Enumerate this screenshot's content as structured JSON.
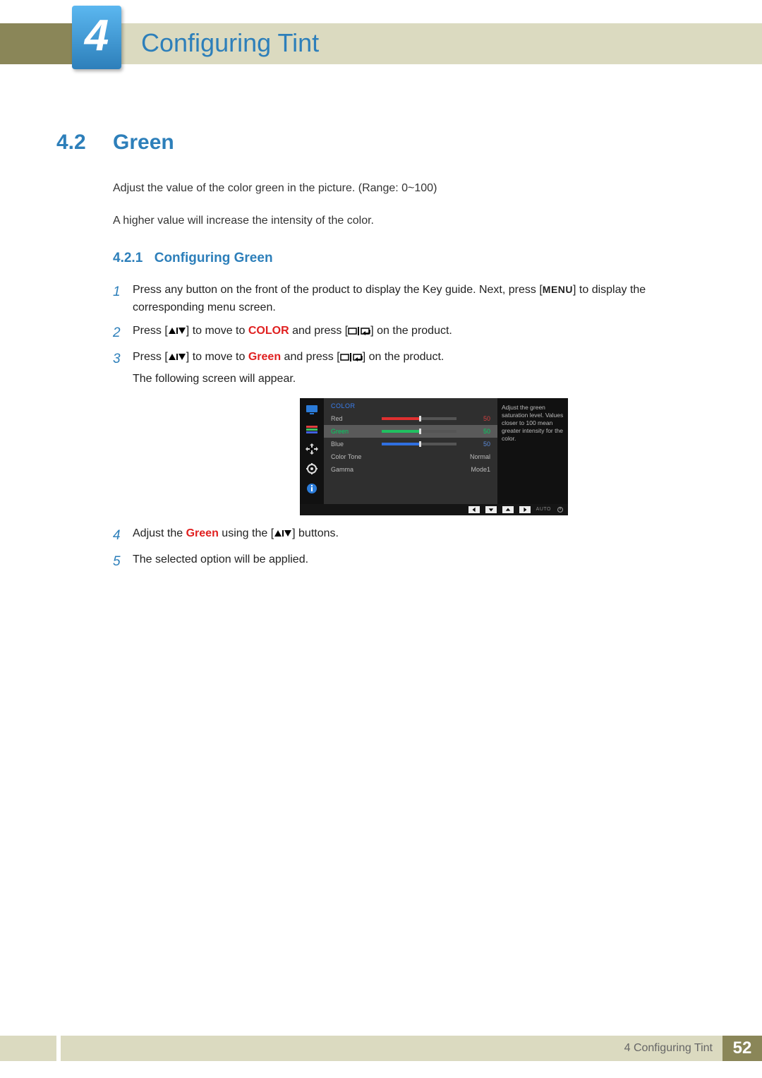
{
  "chapter": {
    "number": "4",
    "title": "Configuring Tint"
  },
  "section": {
    "number": "4.2",
    "title": "Green"
  },
  "intro": {
    "p1": "Adjust the value of the color green in the picture. (Range: 0~100)",
    "p2": "A higher value will increase the intensity of the color."
  },
  "subsection": {
    "number": "4.2.1",
    "title": "Configuring Green"
  },
  "steps": {
    "s1": {
      "num": "1",
      "pre": "Press any button on the front of the product to display the Key guide. Next, press [",
      "menu": "MENU",
      "post": "] to display the corresponding menu screen."
    },
    "s2": {
      "num": "2",
      "pre": "Press [",
      "mid1": "] to move to ",
      "kw": "COLOR",
      "mid2": " and press [",
      "post": "] on the product."
    },
    "s3": {
      "num": "3",
      "pre": "Press [",
      "mid1": "] to move to ",
      "kw": "Green",
      "mid2": " and press [",
      "post": "] on the product.",
      "tail": "The following screen will appear."
    },
    "s4": {
      "num": "4",
      "pre": "Adjust the ",
      "kw": "Green",
      "mid": " using the [",
      "post": "] buttons."
    },
    "s5": {
      "num": "5",
      "text": "The selected option will be applied."
    }
  },
  "osd": {
    "heading": "COLOR",
    "side_text": "Adjust the green saturation level. Values closer to 100 mean greater intensity for the color.",
    "rows": {
      "red": {
        "label": "Red",
        "value": "50",
        "fill": 50,
        "color": "#e03030"
      },
      "green": {
        "label": "Green",
        "value": "50",
        "fill": 50,
        "color": "#20c060"
      },
      "blue": {
        "label": "Blue",
        "value": "50",
        "fill": 50,
        "color": "#3070e0"
      },
      "tone": {
        "label": "Color Tone",
        "value": "Normal"
      },
      "gamma": {
        "label": "Gamma",
        "value": "Mode1"
      }
    },
    "nav": {
      "auto": "AUTO"
    }
  },
  "footer": {
    "chapter_label": "4 Configuring Tint",
    "page": "52"
  }
}
